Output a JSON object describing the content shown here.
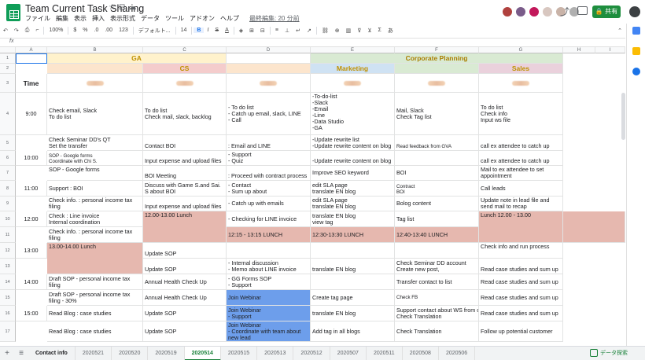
{
  "app": {
    "title": "Team Current Task Sharing",
    "menu": [
      "ファイル",
      "編集",
      "表示",
      "挿入",
      "表示形式",
      "データ",
      "ツール",
      "アドオン",
      "ヘルプ"
    ],
    "last_edit": "最終編集: 20 分前",
    "share_label": "共有",
    "avatar_colors": [
      "#b0413e",
      "#7a5c8a",
      "#c2185b",
      "#d8c7c0",
      "#c9b3a8",
      "#b0b0b0"
    ]
  },
  "toolbar": {
    "zoom": "100%",
    "currency": "$",
    "percent": "%",
    "decimal_dec": ".0",
    "decimal_inc": ".00",
    "format_123": "123",
    "font": "デフォルト...",
    "font_size": "14",
    "bold": "B",
    "italic": "I",
    "strike": "S",
    "text_color": "A"
  },
  "formula_bar": {
    "fx": "fx"
  },
  "grid": {
    "columns": [
      "A",
      "B",
      "C",
      "D",
      "E",
      "F",
      "G",
      "H",
      "I"
    ],
    "row_numbers": [
      "1",
      "2",
      "3",
      "4",
      "5",
      "6",
      "7",
      "8",
      "9",
      "10",
      "11",
      "12",
      "13",
      "14",
      "15",
      "16",
      "17"
    ],
    "cells": {
      "r1_ga": "GA",
      "r1_cp": "Corporate Planning",
      "r2_cs": "CS",
      "r2_marketing": "Marketing",
      "r2_sales": "Sales",
      "r3_time": "Time",
      "r4_time": "9:00",
      "r4_b": "Check email, Slack\nTo do list",
      "r4_c": "To do list\nCheck mail, slack, backlog",
      "r4_d": "- To do list\n- Catch up email, slack, LINE\n- Call",
      "r4_e": "-To-do-list\n-Slack\n-Email\n-Line\n-Data Studio\n-GA",
      "r4_f": "Mail, Slack\nCheck Tag list",
      "r4_g": "To do list\nCheck info\nInput ws file",
      "r5_b": "Check Seminar DD's QT\nSet the transfer",
      "r5_c": "Contact BOI",
      "r5_d": ": Email and LINE",
      "r5_e": "-Update rewrite list\n-Update rewrite content on blog",
      "r5_f": "Read feedback from GVA",
      "r5_g": "call ex attendee to catch up",
      "r6_time": "10:00",
      "r6_b": "SOP - Google forms\nCoordinate with Chi S.",
      "r6_c": "Input expense and upload files",
      "r6_d": "- Support\n- Quiz",
      "r6_e": "-Update rewrite content on blog",
      "r6_g": "call ex attendee to catch up",
      "r7_b": "SOP - Google forms",
      "r7_c": "BOI Meeting",
      "r7_d": ": Proceed with contract process",
      "r7_e": "Improve SEO keyword",
      "r7_f": "BOI",
      "r7_g": "Mail to ex attendee to set appointment",
      "r8_time": "11:00",
      "r8_b": "Support : BOI",
      "r8_c": "Discuss with Game S.and Sai. S about BOI",
      "r8_d": "- Contact\n- Sum up about",
      "r8_e": "edit SLA page\ntranslate EN blog",
      "r8_f": "Contract\nBOI",
      "r8_g": "Call leads",
      "r9_b": "Check info. : personal income tax filing",
      "r9_c": "Input expense and upload files",
      "r9_d": "- Catch up with emails",
      "r9_e": "edit SLA page\ntranslate EN blog",
      "r9_f": "Bolog content",
      "r9_g": "Update note in lead file and send mail to recap",
      "r10_time": "12:00",
      "r10_b": "Check : Line invoice\nInternal coordination",
      "r10_c": "12.00-13.00 Lunch",
      "r10_d": "- Checking for LINE invoice",
      "r10_e": "translate EN blog\nview tag",
      "r10_f": "Tag list",
      "r10_g": "Lunch 12.00 - 13.00",
      "r11_b": "Check info. : personal income tax filing",
      "r11_d": "12:15 - 13:15 LUNCH",
      "r11_e": "12:30-13:30 LUNCH",
      "r11_f": "12:40-13:40 LUNCH",
      "r12_time": "13:00",
      "r12_b": "13.00-14.00 Lunch",
      "r12_c": "Update SOP",
      "r12_g": "Check info and run process",
      "r13_c": "Update SOP",
      "r13_d": "- Internal discussion\n- Memo about LINE invoice",
      "r13_e": "translate EN blog",
      "r13_f": "Check Seminar DD account\nCreate new post,",
      "r13_g": "Read case studies and sum up",
      "r14_time": "14:00",
      "r14_b": "Draft SOP - personal income tax filing",
      "r14_c": "Annual Health Check Up",
      "r14_d": "- GG Forms SOP\n- Support",
      "r14_e": "translate EN blog",
      "r14_f": "Transfer contact to list",
      "r14_g": "Read case studies and sum up",
      "r15_b": "Draft SOP - personal income tax filing - 30%",
      "r15_c": "Annual Health Check Up",
      "r15_d": "Join Webinar",
      "r15_e": "Create tag page",
      "r15_f": "Check FB",
      "r15_g": "Read case studies and sum up",
      "r16_time": "15:00",
      "r16_b": "Read Blog : case studies",
      "r16_c": "Update SOP",
      "r16_d": "Join Webinar\n- Support",
      "r16_e": "translate EN blog",
      "r16_f": "Support contact about WS from c\nCheck Translation",
      "r16_g": "Read case studies and sum up",
      "r17_b": "Read Blog : case studies",
      "r17_c": "Update SOP",
      "r17_d": "Join Webinar\n- Coordinate with team about new lead",
      "r17_e": "Add tag in all blogs",
      "r17_f": "Check Translation",
      "r17_g": "Follow up potential customer"
    }
  },
  "sheet_tabs": [
    "Contact info",
    "2020521",
    "2020520",
    "2020519",
    "2020514",
    "2020515",
    "2020513",
    "2020512",
    "2020507",
    "2020511",
    "2020508",
    "2020506"
  ],
  "active_tab": "2020514",
  "explore_label": "データ探索",
  "colors": {
    "ga_header": "#fff2cc",
    "cs_header": "#f4cccc",
    "marketing_header": "#cfe2f3",
    "cp_header": "#d9ead3",
    "sales_header": "#ead1dc",
    "lunch": "#e6b8af",
    "webinar": "#6d9eeb",
    "share_green": "#1e8e3e"
  }
}
